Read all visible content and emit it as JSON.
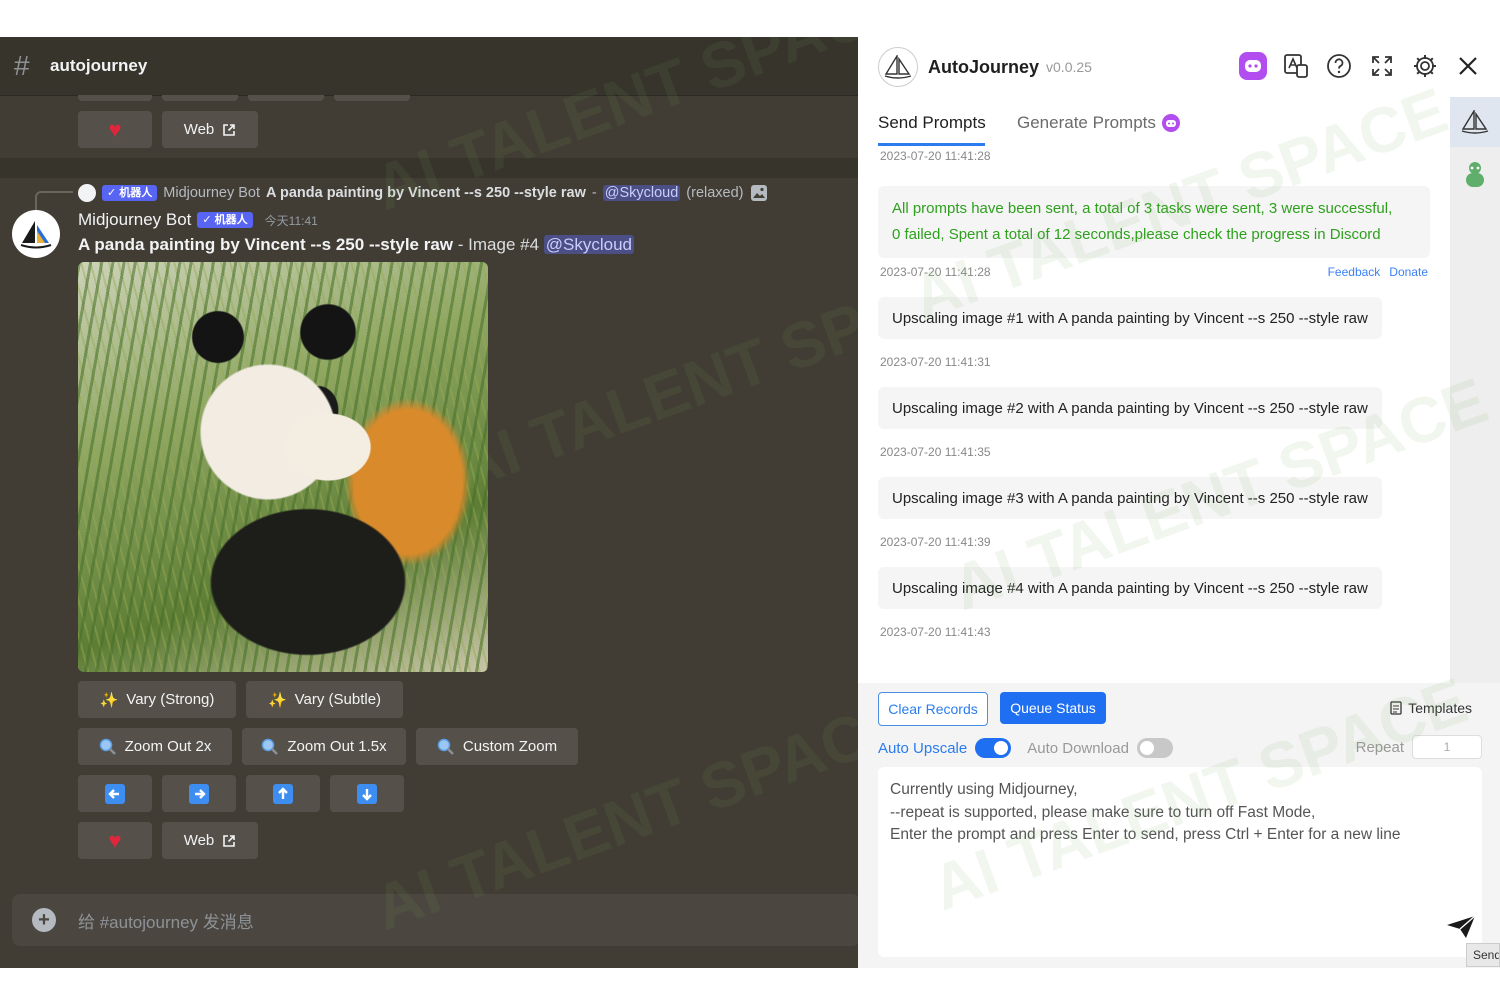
{
  "discord": {
    "channel": {
      "hash": "#",
      "name": "autojourney"
    },
    "top_buttons": {
      "web_label": "Web"
    },
    "reply": {
      "bot_tag": "✓ 机器人",
      "author": "Midjourney Bot",
      "prompt": "A panda painting by Vincent --s 250 --style raw",
      "separator": "-",
      "mention": "@Skycloud",
      "mode": "(relaxed)"
    },
    "message": {
      "author": "Midjourney Bot",
      "bot_tag": "✓ 机器人",
      "timestamp": "今天11:41",
      "prompt": "A panda painting by Vincent --s 250 --style raw",
      "suffix": "- Image #4",
      "mention": "@Skycloud"
    },
    "buttons": {
      "vary_strong": "Vary (Strong)",
      "vary_subtle": "Vary (Subtle)",
      "zoom_out_2x": "Zoom Out 2x",
      "zoom_out_1_5x": "Zoom Out 1.5x",
      "custom_zoom": "Custom Zoom",
      "web_label": "Web"
    },
    "input_placeholder": "给 #autojourney 发消息"
  },
  "panel": {
    "title": "AutoJourney",
    "version": "v0.0.25",
    "tabs": {
      "send": "Send Prompts",
      "generate": "Generate Prompts"
    },
    "log": {
      "ts_top": "2023-07-20 11:41:28",
      "summary_line1": "All prompts have been sent, a total of 3 tasks were sent, 3 were successful,",
      "summary_line2": "0 failed, Spent a total of  12 seconds,please check the progress in Discord",
      "ts_summary": "2023-07-20 11:41:28",
      "feedback": "Feedback",
      "donate": "Donate",
      "entries": [
        {
          "text": "Upscaling image #1 with A panda painting by Vincent --s 250 --style raw",
          "ts": "2023-07-20 11:41:31"
        },
        {
          "text": "Upscaling image #2 with A panda painting by Vincent --s 250 --style raw",
          "ts": "2023-07-20 11:41:35"
        },
        {
          "text": "Upscaling image #3 with A panda painting by Vincent --s 250 --style raw",
          "ts": "2023-07-20 11:41:39"
        },
        {
          "text": "Upscaling image #4 with A panda painting by Vincent --s 250 --style raw",
          "ts": "2023-07-20 11:41:43"
        }
      ]
    },
    "controls": {
      "clear_records": "Clear Records",
      "queue_status": "Queue Status",
      "templates": "Templates",
      "auto_upscale": "Auto Upscale",
      "auto_upscale_on": true,
      "auto_download": "Auto Download",
      "auto_download_on": false,
      "repeat_label": "Repeat",
      "repeat_value": "1",
      "prompt_line1": "Currently using Midjourney,",
      "prompt_line2": "--repeat is supported, please make sure to turn off Fast Mode,",
      "prompt_line3": "Enter the prompt and press Enter to send, press Ctrl + Enter for a new line",
      "send_label": "Send"
    }
  },
  "watermark": "AI TALENT SPACE",
  "colors": {
    "discord_bg": "#413d34",
    "accent_blue": "#1f6ff2",
    "success_green": "#2ea01e",
    "bot_tag": "#5865f2",
    "heart": "#e0263b"
  }
}
